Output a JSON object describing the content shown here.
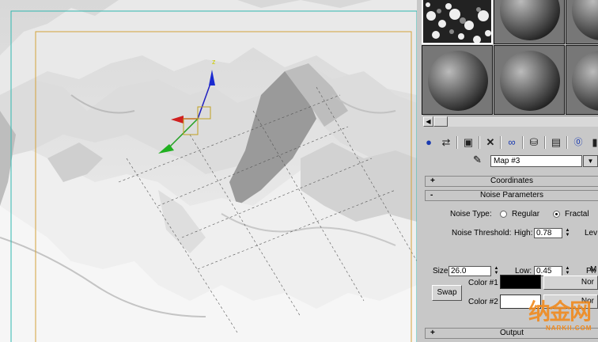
{
  "viewport": {
    "gizmo": {
      "z_label": "z"
    }
  },
  "material_editor": {
    "slots": [
      "noise-slot",
      "sphere-slot-2",
      "sphere-slot-3",
      "sphere-slot-4",
      "sphere-slot-5",
      "sphere-slot-6"
    ],
    "toolbar_icons": [
      "get-material-icon",
      "put-to-scene-icon",
      "assign-material-icon",
      "delete-icon",
      "make-unique-icon",
      "put-to-library-icon",
      "material-id-icon",
      "show-map-icon",
      "show-end-result-icon"
    ],
    "map_name": "Map #3",
    "rollouts": {
      "coordinates": {
        "sign": "+",
        "title": "Coordinates"
      },
      "noise_params": {
        "sign": "-",
        "title": "Noise Parameters"
      },
      "output": {
        "sign": "+",
        "title": "Output"
      }
    },
    "noise": {
      "type_label": "Noise Type:",
      "regular_label": "Regular",
      "fractal_label": "Fractal",
      "selected": "fractal",
      "threshold_label": "Noise Threshold:",
      "high_label": "High:",
      "high_value": "0.78",
      "low_label": "Low:",
      "low_value": "0.45",
      "size_label": "Size:",
      "size_value": "26.0",
      "levels_label": "Lev",
      "phase_label": "Ph",
      "maps_label": "M"
    },
    "colors": {
      "swap_label": "Swap",
      "color1_label": "Color #1",
      "color1": "#000000",
      "color2_label": "Color #2",
      "color2": "#ffffff",
      "none1": "Nor",
      "none2": "Nor"
    }
  },
  "watermark": {
    "text": "纳金网",
    "sub": "NARKII.COM"
  }
}
